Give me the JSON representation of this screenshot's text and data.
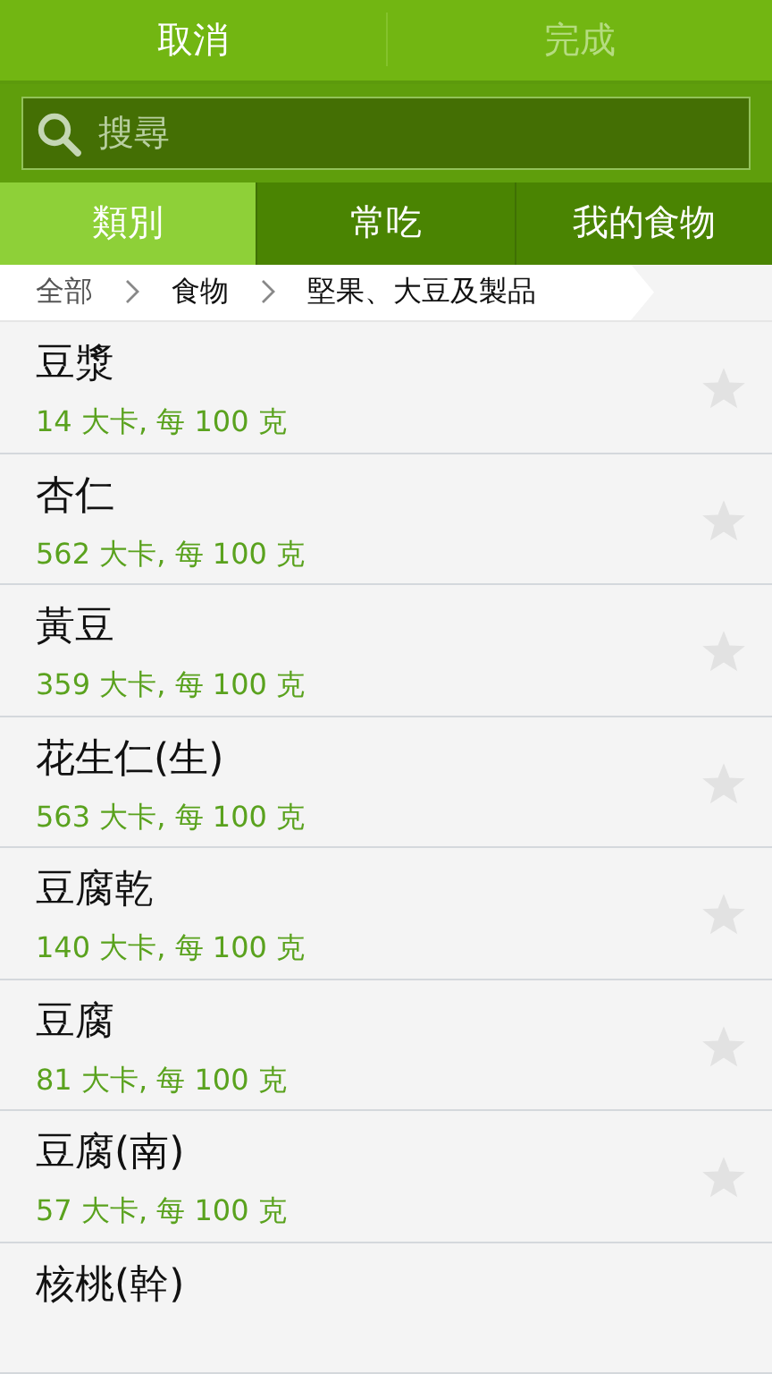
{
  "header": {
    "cancel": {
      "label": "取消",
      "disabled": false
    },
    "done": {
      "label": "完成",
      "disabled": true
    }
  },
  "search": {
    "placeholder": "搜尋"
  },
  "tabs": [
    {
      "label": "類別",
      "selected": true
    },
    {
      "label": "常吃",
      "selected": false
    },
    {
      "label": "我的食物",
      "selected": false
    }
  ],
  "breadcrumb": [
    "全部",
    "食物",
    "堅果、大豆及製品"
  ],
  "foods": [
    {
      "name": "豆漿",
      "calories": "14 大卡, 每 100 克",
      "favorite": false
    },
    {
      "name": "杏仁",
      "calories": "562 大卡, 每 100 克",
      "favorite": false
    },
    {
      "name": "黃豆",
      "calories": "359 大卡, 每 100 克",
      "favorite": false
    },
    {
      "name": "花生仁(生)",
      "calories": "563 大卡, 每 100 克",
      "favorite": false
    },
    {
      "name": "豆腐乾",
      "calories": "140 大卡, 每 100 克",
      "favorite": false
    },
    {
      "name": "豆腐",
      "calories": "81 大卡, 每 100 克",
      "favorite": false
    },
    {
      "name": "豆腐(南)",
      "calories": "57 大卡, 每 100 克",
      "favorite": false
    },
    {
      "name": "核桃(幹)"
    }
  ]
}
